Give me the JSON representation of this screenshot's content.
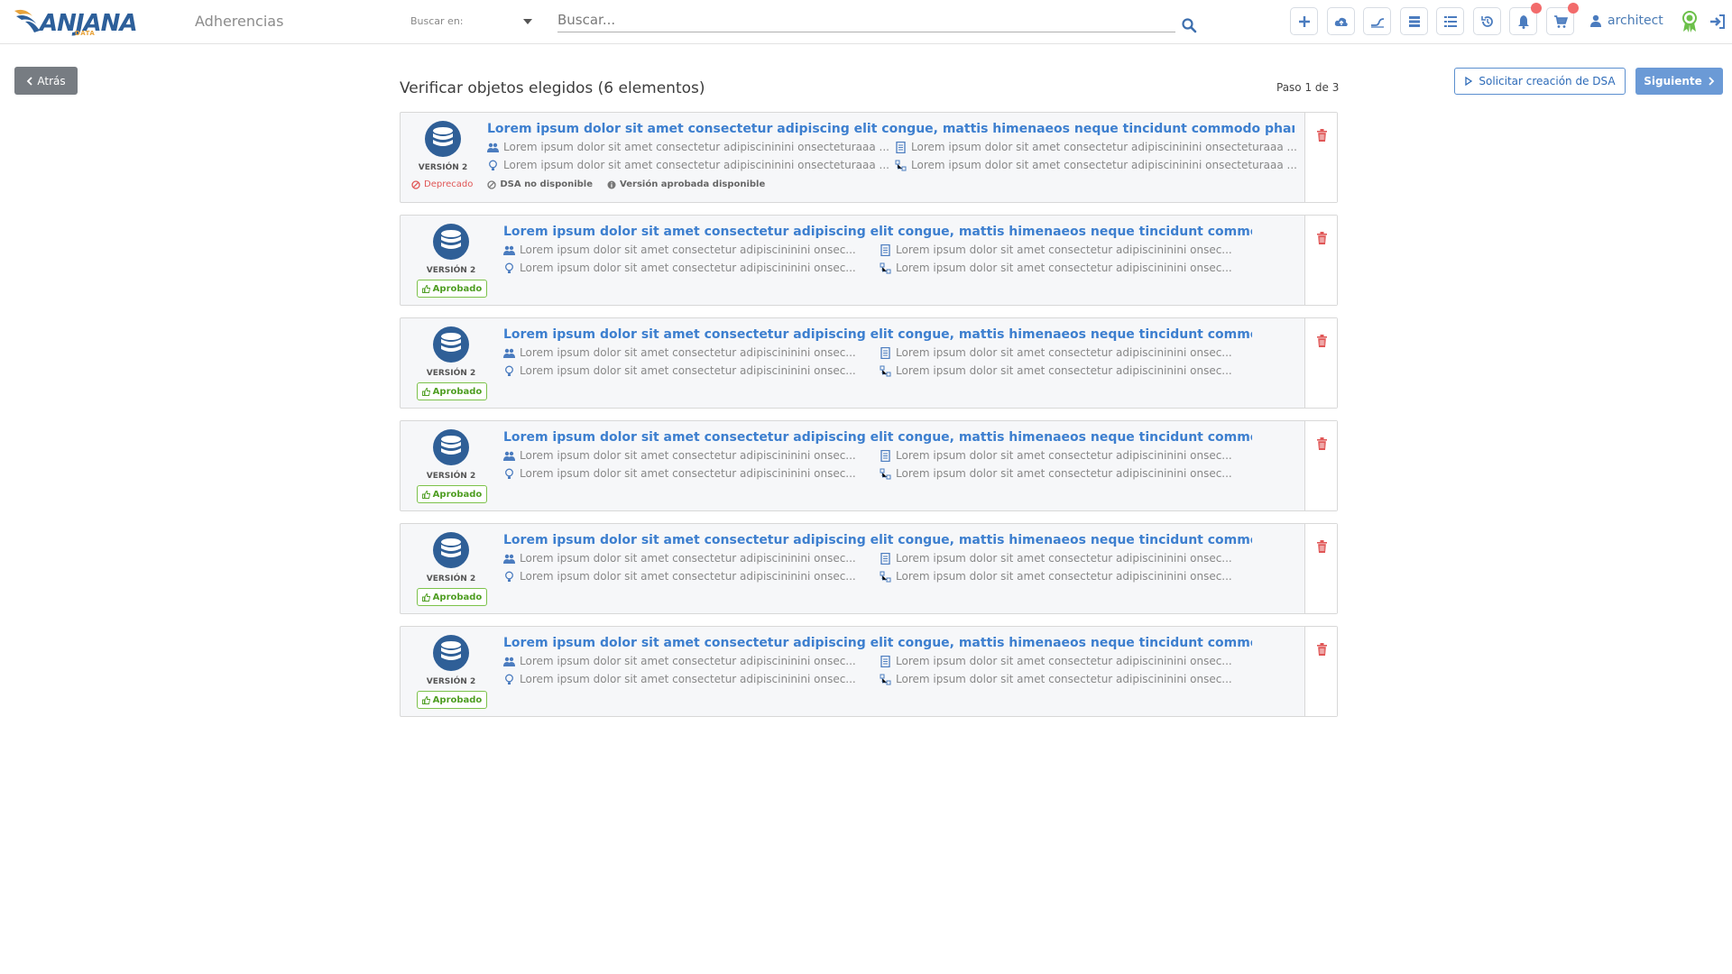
{
  "app": {
    "logo_text": "ANJANA",
    "logo_sub": "DATA",
    "section": "Adherencias"
  },
  "search": {
    "scope_label": "Buscar en:",
    "placeholder": "Buscar..."
  },
  "toolbar": {
    "buttons": [
      "plus-icon",
      "cloud-upload-icon",
      "lineage-icon",
      "database-icon",
      "list-icon",
      "history-icon",
      "bell-icon",
      "cart-icon"
    ],
    "badges": {
      "bell": true,
      "cart": true
    }
  },
  "user": {
    "name": "architect"
  },
  "nav": {
    "back_label": "Atrás",
    "title": "Verificar objetos elegidos (6 elementos)",
    "step": "Paso 1 de 3",
    "dsa_label": "Solicitar creación de DSA",
    "next_label": "Siguiente"
  },
  "colors": {
    "accent": "#3d7fcf",
    "approved": "#4f9e23",
    "deprecated": "#e05656",
    "badge": "#f26b6b"
  },
  "items": [
    {
      "title": "Lorem ipsum dolor sit amet consectetur adipiscing elit congue, mattis himenaeos neque tincidunt commodo pharetra sem...",
      "version": "VERSIÓN 2",
      "meta_left_1": "Lorem ipsum dolor sit amet consectetur adipiscininini onsecteturaaa ...",
      "meta_left_2": "Lorem ipsum dolor sit amet consectetur adipiscininini onsecteturaaa ...",
      "meta_right_1": "Lorem ipsum dolor sit amet consectetur adipiscininini onsecteturaaa ...",
      "meta_right_2": "Lorem ipsum dolor sit amet consectetur adipiscininini onsecteturaaa ...",
      "status": "Deprecado",
      "dsa_flag": "DSA no disponible",
      "approved_flag": "Versión aprobada disponible"
    },
    {
      "title": "Lorem ipsum dolor sit amet consectetur adipiscing elit congue, mattis himenaeos neque tincidunt commode...",
      "version": "VERSIÓN 2",
      "meta_left_1": "Lorem ipsum dolor sit amet consectetur adipiscininini onsec...",
      "meta_left_2": "Lorem ipsum dolor sit amet consectetur adipiscininini onsec...",
      "meta_right_1": "Lorem ipsum dolor sit amet consectetur adipiscininini onsec...",
      "meta_right_2": "Lorem ipsum dolor sit amet consectetur adipiscininini onsec...",
      "status": "Aprobado"
    },
    {
      "title": "Lorem ipsum dolor sit amet consectetur adipiscing elit congue, mattis himenaeos neque tincidunt commode...",
      "version": "VERSIÓN 2",
      "meta_left_1": "Lorem ipsum dolor sit amet consectetur adipiscininini onsec...",
      "meta_left_2": "Lorem ipsum dolor sit amet consectetur adipiscininini onsec...",
      "meta_right_1": "Lorem ipsum dolor sit amet consectetur adipiscininini onsec...",
      "meta_right_2": "Lorem ipsum dolor sit amet consectetur adipiscininini onsec...",
      "status": "Aprobado"
    },
    {
      "title": "Lorem ipsum dolor sit amet consectetur adipiscing elit congue, mattis himenaeos neque tincidunt commode...",
      "version": "VERSIÓN 2",
      "meta_left_1": "Lorem ipsum dolor sit amet consectetur adipiscininini onsec...",
      "meta_left_2": "Lorem ipsum dolor sit amet consectetur adipiscininini onsec...",
      "meta_right_1": "Lorem ipsum dolor sit amet consectetur adipiscininini onsec...",
      "meta_right_2": "Lorem ipsum dolor sit amet consectetur adipiscininini onsec...",
      "status": "Aprobado"
    },
    {
      "title": "Lorem ipsum dolor sit amet consectetur adipiscing elit congue, mattis himenaeos neque tincidunt commode...",
      "version": "VERSIÓN 2",
      "meta_left_1": "Lorem ipsum dolor sit amet consectetur adipiscininini onsec...",
      "meta_left_2": "Lorem ipsum dolor sit amet consectetur adipiscininini onsec...",
      "meta_right_1": "Lorem ipsum dolor sit amet consectetur adipiscininini onsec...",
      "meta_right_2": "Lorem ipsum dolor sit amet consectetur adipiscininini onsec...",
      "status": "Aprobado"
    },
    {
      "title": "Lorem ipsum dolor sit amet consectetur adipiscing elit congue, mattis himenaeos neque tincidunt commode...",
      "version": "VERSIÓN 2",
      "meta_left_1": "Lorem ipsum dolor sit amet consectetur adipiscininini onsec...",
      "meta_left_2": "Lorem ipsum dolor sit amet consectetur adipiscininini onsec...",
      "meta_right_1": "Lorem ipsum dolor sit amet consectetur adipiscininini onsec...",
      "meta_right_2": "Lorem ipsum dolor sit amet consectetur adipiscininini onsec...",
      "status": "Aprobado"
    }
  ]
}
